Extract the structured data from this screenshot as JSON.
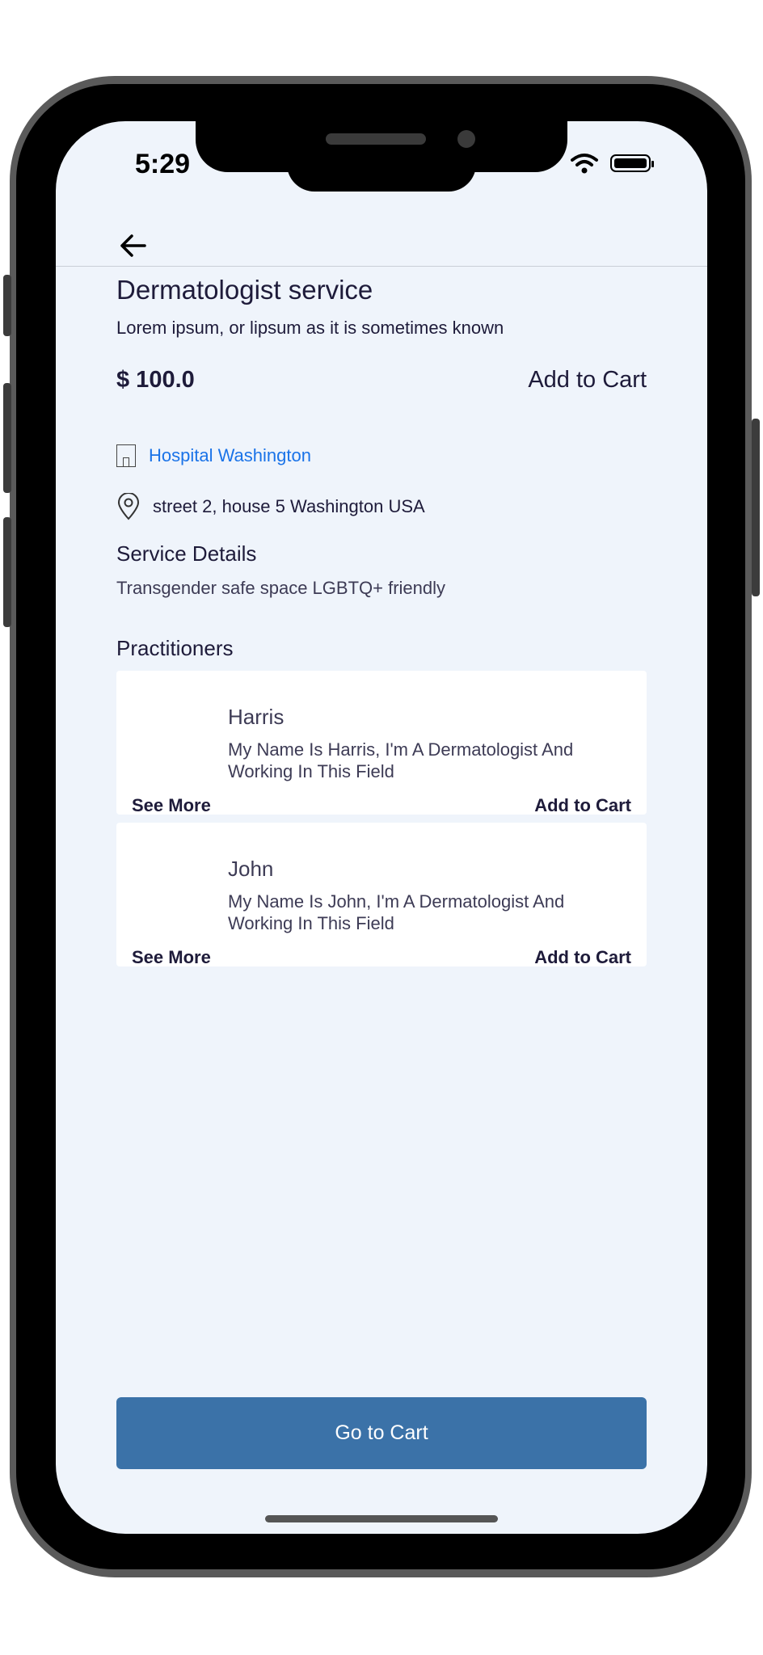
{
  "status_bar": {
    "time": "5:29"
  },
  "service": {
    "title": "Dermatologist service",
    "subtitle": "Lorem ipsum, or lipsum as it is sometimes known",
    "price": "$ 100.0",
    "add_to_cart": "Add to Cart",
    "hospital": "Hospital Washington",
    "address": "street 2, house 5 Washington USA"
  },
  "service_details": {
    "heading": "Service Details",
    "text": "Transgender safe space LGBTQ+ friendly"
  },
  "practitioners": {
    "heading": "Practitioners",
    "items": [
      {
        "name": "Harris",
        "description": "My Name Is Harris, I'm A Dermatologist And Working In This Field",
        "see_more": "See More",
        "add_to_cart": "Add to Cart"
      },
      {
        "name": "John",
        "description": "My Name Is John, I'm A Dermatologist And Working In This Field",
        "see_more": "See More",
        "add_to_cart": "Add to Cart"
      }
    ]
  },
  "footer": {
    "go_to_cart": "Go to Cart"
  },
  "colors": {
    "background": "#eff4fb",
    "accent": "#3b72a8",
    "link": "#1a73e8",
    "text": "#1e1b3a"
  }
}
